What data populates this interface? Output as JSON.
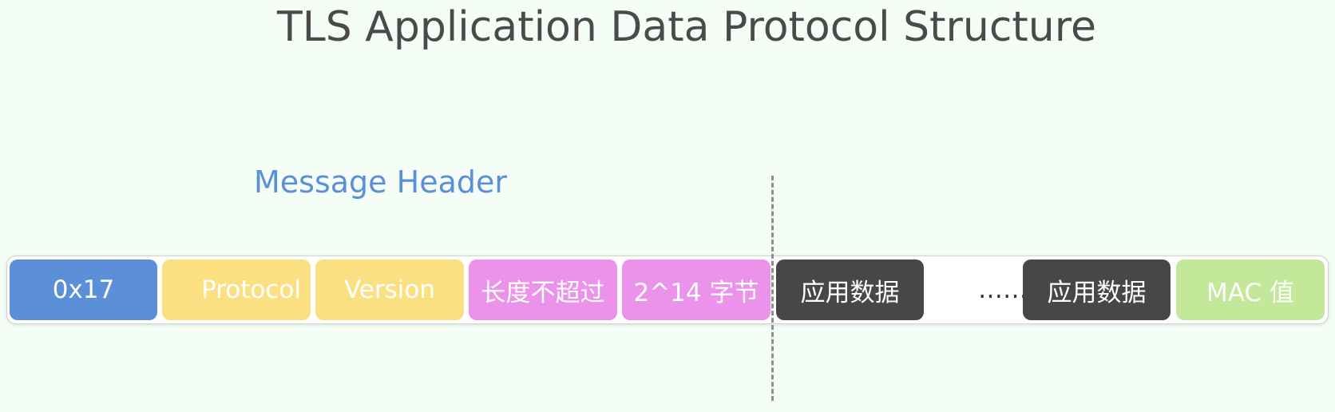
{
  "title": "TLS Application Data Protocol Structure",
  "header_label": "Message Header",
  "fields": {
    "content_type": "0x17",
    "protocol": "Protocol",
    "version": "Version",
    "length_part1": "长度不超过",
    "length_part2": "2^14 字节",
    "app_data_1": "应用数据",
    "ellipsis": "……",
    "app_data_2": "应用数据",
    "mac": "MAC 值"
  },
  "colors": {
    "content_type": "#5b8fd8",
    "protocol_version": "#fbe082",
    "length": "#eb93ea",
    "app_data": "#474747",
    "mac": "#c3e899",
    "header_label": "#5b8fd8"
  }
}
